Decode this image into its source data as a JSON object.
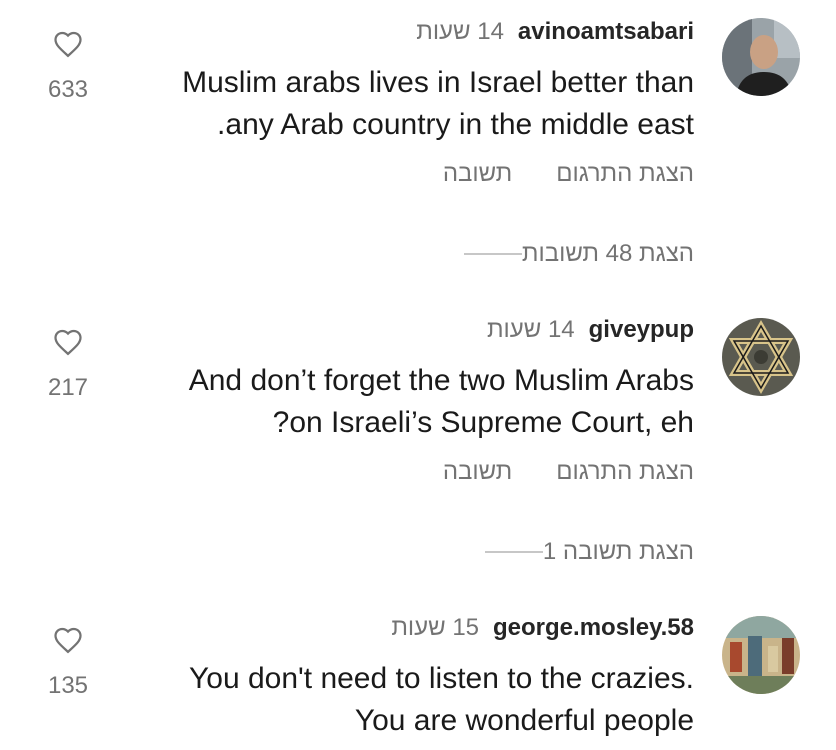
{
  "comments": [
    {
      "username": "avinoamtsabari",
      "time": "14 שעות",
      "lines": [
        "Muslim arabs lives in Israel better than",
        ".any Arab country in the middle east"
      ],
      "likes": "633",
      "reply_label": "תשובה",
      "translate_label": "הצגת התרגום",
      "view_replies": "הצגת 48 תשובות",
      "avatar_icon": "person-photo-avatar"
    },
    {
      "username": "giveypup",
      "time": "14 שעות",
      "lines": [
        "And don’t forget the two Muslim Arabs",
        "?on Israeli’s Supreme Court, eh"
      ],
      "likes": "217",
      "reply_label": "תשובה",
      "translate_label": "הצגת התרגום",
      "view_replies": "הצגת תשובה 1",
      "avatar_icon": "star-of-david-avatar"
    },
    {
      "username": "george.mosley.58",
      "time": "15 שעות",
      "lines": [
        "You don't need to listen to the crazies.",
        "You are wonderful people"
      ],
      "likes": "135",
      "avatar_icon": "painting-avatar"
    }
  ],
  "colors": {
    "text_primary": "#1a1a1a",
    "text_secondary": "#737373",
    "divider": "#c7c7c7"
  }
}
